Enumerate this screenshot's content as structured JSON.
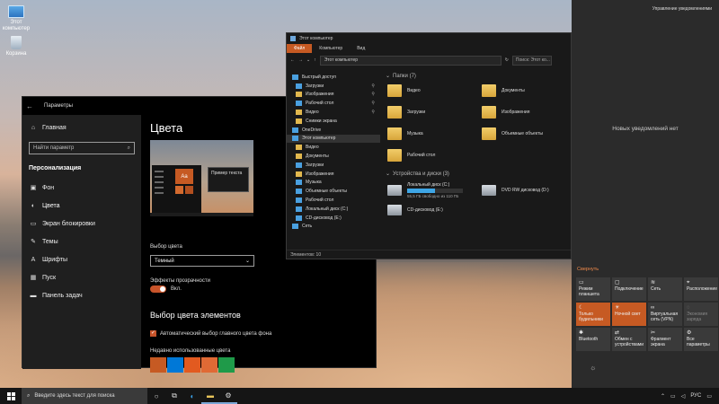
{
  "desktop": {
    "icons": [
      {
        "label": "Этот компьютер",
        "icon": "this-pc-icon"
      },
      {
        "label": "Корзина",
        "icon": "recycle-bin-icon"
      }
    ]
  },
  "settings": {
    "title": "Параметры",
    "home": "Главная",
    "search_placeholder": "Найти параметр",
    "section": "Персонализация",
    "nav": [
      "Фон",
      "Цвета",
      "Экран блокировки",
      "Темы",
      "Шрифты",
      "Пуск",
      "Панель задач"
    ],
    "page_title": "Цвета",
    "preview_text": "Пример текста",
    "preview_tile": "Aa",
    "choose_color_label": "Выбор цвета",
    "choose_color_value": "Темный",
    "transparency_label": "Эффекты прозрачности",
    "transparency_state": "Вкл.",
    "accent_header": "Выбор цвета элементов",
    "auto_accent_label": "Автоматический выбор главного цвета фона",
    "recent_colors_label": "Недавно использованные цвета",
    "recent_colors": [
      "#c65a23",
      "#0078d7",
      "#e25a20",
      "#e06a35",
      "#1f9a49"
    ]
  },
  "explorer": {
    "title": "Этот компьютер",
    "tabs": [
      "Файл",
      "Компьютер",
      "Вид"
    ],
    "address": "Этот компьютер",
    "search_placeholder": "Поиск: Этот ко...",
    "nav": [
      {
        "label": "Быстрый доступ",
        "level": 0,
        "icon": "blue",
        "pinned": false
      },
      {
        "label": "Загрузки",
        "level": 1,
        "icon": "blue",
        "pinned": true
      },
      {
        "label": "Изображения",
        "level": 1,
        "icon": "folder",
        "pinned": true
      },
      {
        "label": "Рабочий стол",
        "level": 1,
        "icon": "blue",
        "pinned": true
      },
      {
        "label": "Видео",
        "level": 1,
        "icon": "folder",
        "pinned": true
      },
      {
        "label": "Снимки экрана",
        "level": 1,
        "icon": "folder",
        "pinned": false
      },
      {
        "label": "OneDrive",
        "level": 0,
        "icon": "blue",
        "pinned": false
      },
      {
        "label": "Этот компьютер",
        "level": 0,
        "icon": "blue",
        "pinned": false
      },
      {
        "label": "Видео",
        "level": 1,
        "icon": "folder",
        "pinned": false
      },
      {
        "label": "Документы",
        "level": 1,
        "icon": "folder",
        "pinned": false
      },
      {
        "label": "Загрузки",
        "level": 1,
        "icon": "blue",
        "pinned": false
      },
      {
        "label": "Изображения",
        "level": 1,
        "icon": "folder",
        "pinned": false
      },
      {
        "label": "Музыка",
        "level": 1,
        "icon": "blue",
        "pinned": false
      },
      {
        "label": "Объемные объекты",
        "level": 1,
        "icon": "blue",
        "pinned": false
      },
      {
        "label": "Рабочий стол",
        "level": 1,
        "icon": "blue",
        "pinned": false
      },
      {
        "label": "Локальный диск (C:)",
        "level": 1,
        "icon": "blue",
        "pinned": false
      },
      {
        "label": "CD-дисковод (E:)",
        "level": 1,
        "icon": "blue",
        "pinned": false
      },
      {
        "label": "Сеть",
        "level": 0,
        "icon": "blue",
        "pinned": false
      }
    ],
    "folders_header": "Папки (7)",
    "folders": [
      "Видео",
      "Документы",
      "Загрузки",
      "Изображения",
      "Музыка",
      "Объемные объекты",
      "Рабочий стол"
    ],
    "devices_header": "Устройства и диски (3)",
    "drives": [
      {
        "name": "Локальный диск (C:)",
        "free": "55,5 ГБ свободно из 110 ГБ",
        "used_fraction": 0.5
      },
      {
        "name": "DVD RW дисковод (D:)",
        "free": "",
        "used_fraction": null
      },
      {
        "name": "CD-дисковод (E:)",
        "free": "",
        "used_fraction": null
      }
    ],
    "status": "Элементов: 10"
  },
  "action_center": {
    "manage": "Управление уведомлениями",
    "no_notifications": "Новых уведомлений нет",
    "collapse": "Свернуть",
    "tiles": [
      {
        "label": "Режим планшета",
        "icon": "▭",
        "state": "normal"
      },
      {
        "label": "Подключение",
        "icon": "▢",
        "state": "normal"
      },
      {
        "label": "Сеть",
        "icon": "≋",
        "state": "normal"
      },
      {
        "label": "Расположение",
        "icon": "⌖",
        "state": "normal"
      },
      {
        "label": "Только будильники",
        "icon": "☾",
        "state": "on"
      },
      {
        "label": "Ночной свет",
        "icon": "☀",
        "state": "on"
      },
      {
        "label": "Виртуальная сеть (VPN)",
        "icon": "∞",
        "state": "normal"
      },
      {
        "label": "Экономия заряда",
        "icon": "◌",
        "state": "off"
      },
      {
        "label": "Bluetooth",
        "icon": "✱",
        "state": "normal"
      },
      {
        "label": "Обмен с устройствами",
        "icon": "⇄",
        "state": "normal"
      },
      {
        "label": "Фрагмент экрана",
        "icon": "✂",
        "state": "normal"
      },
      {
        "label": "Все параметры",
        "icon": "⚙",
        "state": "normal"
      }
    ]
  },
  "taskbar": {
    "search_placeholder": "Введите здесь текст для поиска",
    "language": "РУС"
  }
}
